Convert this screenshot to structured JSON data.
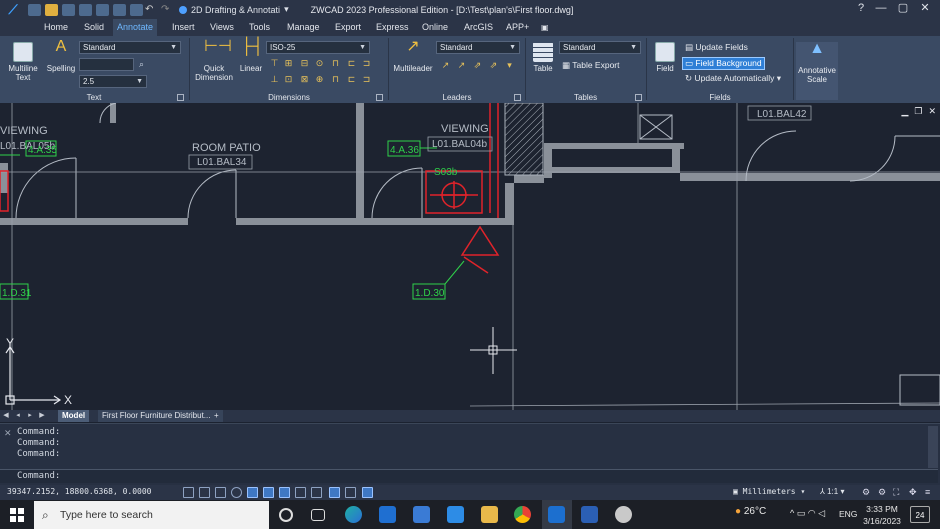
{
  "titlebar": {
    "workspace": "2D Drafting & Annotati",
    "window_title": "ZWCAD 2023 Professional Edition - [D:\\Test\\plan's\\First floor.dwg]",
    "minimize": "—",
    "maximize": "▢",
    "close": "✕",
    "help": "?"
  },
  "tabs": [
    "Home",
    "Solid",
    "Annotate",
    "Insert",
    "Views",
    "Tools",
    "Manage",
    "Export",
    "Express",
    "Online",
    "ArcGIS",
    "APP+"
  ],
  "active_tab": "Annotate",
  "ribbon": {
    "text_panel": {
      "label": "Text",
      "multiline_text": "Multiline\nText",
      "spelling": "Spelling",
      "style": "Standard",
      "find_placeholder": "",
      "height": "2.5"
    },
    "dimensions_panel": {
      "label": "Dimensions",
      "quick_dimension": "Quick\nDimension",
      "linear": "Linear",
      "style": "ISO-25"
    },
    "leaders_panel": {
      "label": "Leaders",
      "multileader": "Multileader",
      "style": "Standard"
    },
    "tables_panel": {
      "label": "Tables",
      "table": "Table",
      "style": "Standard",
      "table_export": "Table Export"
    },
    "fields_panel": {
      "label": "Fields",
      "field": "Field",
      "update_fields": "Update Fields",
      "field_background": "Field Background",
      "update_automatically": "Update Automatically"
    },
    "annotative_scale": "Annotative\nScale"
  },
  "drawing": {
    "labels": {
      "viewing_left": "VIEWING",
      "room_patio": "ROOM PATIO",
      "room_code": "L01.BAL34",
      "viewing_right": "VIEWING",
      "viewing_code": "L01.BAL04b",
      "code_right": "L01.BAL42",
      "left_code": "L01.BAL05b",
      "tag_4a35": "4.A.35",
      "tag_4a36": "4.A.36",
      "tag_s03b": "S03b",
      "tag_1d31": "1.D.31",
      "tag_1d30": "1.D.30",
      "axis_x": "X",
      "axis_y": "Y"
    }
  },
  "layout_tabs": {
    "model": "Model",
    "layout1": "First Floor Furniture Distribut...",
    "add": "+"
  },
  "command": {
    "history": [
      "Command:",
      "Command:",
      "Command:"
    ],
    "prompt": "Command:"
  },
  "status": {
    "coordinates": "39347.2152, 18800.6368, 0.0000",
    "units": "Millimeters",
    "scale": "1:1"
  },
  "taskbar": {
    "search_placeholder": "Type here to search",
    "temperature": "26°C",
    "language": "ENG",
    "time": "3:33 PM",
    "date": "3/16/2023",
    "notifications": "24"
  }
}
